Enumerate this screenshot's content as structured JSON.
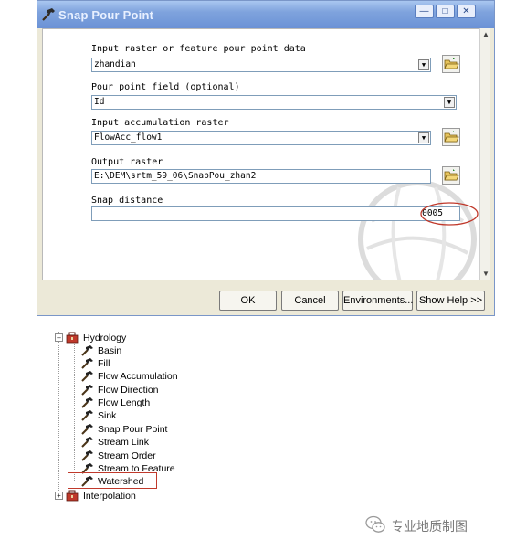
{
  "dialog": {
    "title": "Snap Pour Point",
    "fields": {
      "pour_point_data": {
        "label": "Input raster or feature pour point data",
        "value": "zhandian"
      },
      "pour_point_field": {
        "label": "Pour point field (optional)",
        "value": "Id"
      },
      "accumulation": {
        "label": "Input accumulation raster",
        "value": "FlowAcc_flow1"
      },
      "output": {
        "label": "Output raster",
        "value": "E:\\DEM\\srtm_59_06\\SnapPou_zhan2"
      },
      "snap_distance": {
        "label": "Snap distance",
        "value": "0005"
      }
    },
    "buttons": {
      "ok": "OK",
      "cancel": "Cancel",
      "environments": "Environments...",
      "show_help": "Show Help >>"
    },
    "annotation_color": "#c0392b"
  },
  "tree": {
    "hydrology": {
      "label": "Hydrology",
      "expanded": true,
      "tools": [
        "Basin",
        "Fill",
        "Flow Accumulation",
        "Flow Direction",
        "Flow Length",
        "Sink",
        "Snap Pour Point",
        "Stream Link",
        "Stream Order",
        "Stream to Feature",
        "Watershed"
      ]
    },
    "interpolation": {
      "label": "Interpolation",
      "expanded": false
    },
    "highlighted_tool": "Watershed"
  },
  "watermark": {
    "text": "专业地质制图"
  }
}
